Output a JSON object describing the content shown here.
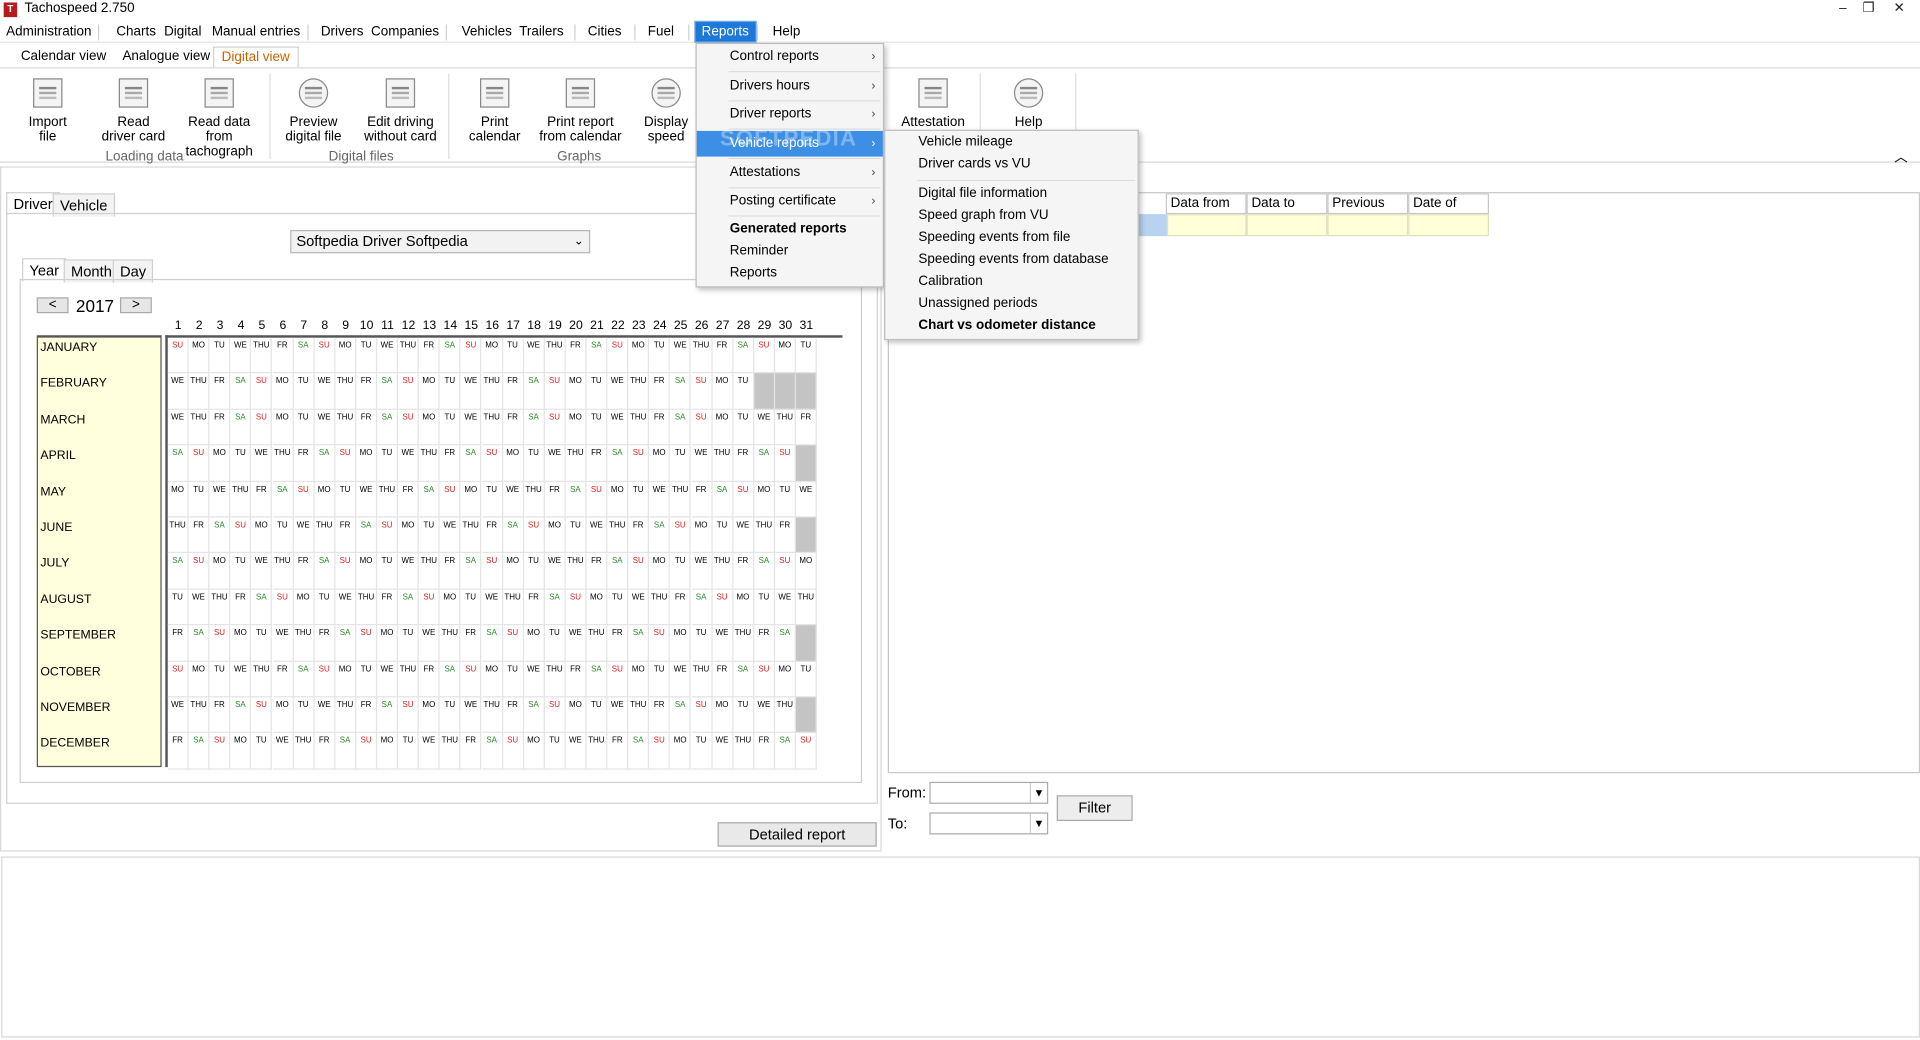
{
  "app": {
    "title": "Tachospeed 2.750",
    "icon_text": "T"
  },
  "window_controls": {
    "minimize": "–",
    "restore": "❐",
    "close": "✕"
  },
  "menubar": [
    "Administration",
    "Charts",
    "Digital",
    "Manual entries",
    "Drivers",
    "Companies",
    "Vehicles",
    "Trailers",
    "Cities",
    "Fuel",
    "Reports",
    "Help"
  ],
  "ribbon_tabs": [
    "Calendar view",
    "Analogue view",
    "Digital view"
  ],
  "ribbon": {
    "buttons": [
      {
        "label1": "Import",
        "label2": "file",
        "icon": "import-file-icon"
      },
      {
        "label1": "Read",
        "label2": "driver card",
        "icon": "card-reader-icon"
      },
      {
        "label1": "Read data from",
        "label2": "tachograph",
        "icon": "tachograph-icon"
      },
      {
        "label1": "Preview",
        "label2": "digital file",
        "icon": "magnifier-icon"
      },
      {
        "label1": "Edit driving",
        "label2": "without card",
        "icon": "edit-card-icon"
      },
      {
        "label1": "Print",
        "label2": "calendar",
        "icon": "printer-icon"
      },
      {
        "label1": "Print report",
        "label2": "from calendar",
        "icon": "printer-report-icon"
      },
      {
        "label1": "Display",
        "label2": "speed",
        "icon": "speedometer-icon"
      },
      {
        "label1": "Attestation of",
        "label2": "",
        "icon": "attestation-doc-icon"
      },
      {
        "label1": "Help",
        "label2": "",
        "icon": "question-icon"
      }
    ],
    "groups": [
      "Loading data",
      "Digital files",
      "Graphs"
    ],
    "collapse": "︿"
  },
  "left": {
    "tabs": [
      "Driver",
      "Vehicle"
    ],
    "driver": "Softpedia Driver Softpedia",
    "period_tabs": [
      "Year",
      "Month",
      "Day"
    ],
    "prev": "<",
    "next": ">",
    "year": "2017",
    "months": [
      "JANUARY",
      "FEBRUARY",
      "MARCH",
      "APRIL",
      "MAY",
      "JUNE",
      "JULY",
      "AUGUST",
      "SEPTEMBER",
      "OCTOBER",
      "NOVEMBER",
      "DECEMBER"
    ],
    "detailed_report": "Detailed report"
  },
  "right": {
    "columns": [
      "Data from",
      "Data to",
      "Previous",
      "Date of import"
    ],
    "from_label": "From:",
    "to_label": "To:",
    "filter": "Filter"
  },
  "reports_menu": {
    "items": [
      "Control reports",
      "Drivers hours",
      "Driver reports",
      "Vehicle reports",
      "Attestations",
      "Posting certificate",
      "Generated reports",
      "Reminder",
      "Reports"
    ],
    "submenu": [
      "Vehicle mileage",
      "Driver cards vs VU",
      "Digital file information",
      "Speed graph from VU",
      "Speeding events from file",
      "Speeding events from database",
      "Calibration",
      "Unassigned periods",
      "Chart vs odometer distance"
    ]
  },
  "watermark": "SOFTPEDIA",
  "calendar_legend": {
    "saturday_color": "#2b8a2b",
    "sunday_color": "#dd2222",
    "empty_color": "#c4c4c4"
  }
}
